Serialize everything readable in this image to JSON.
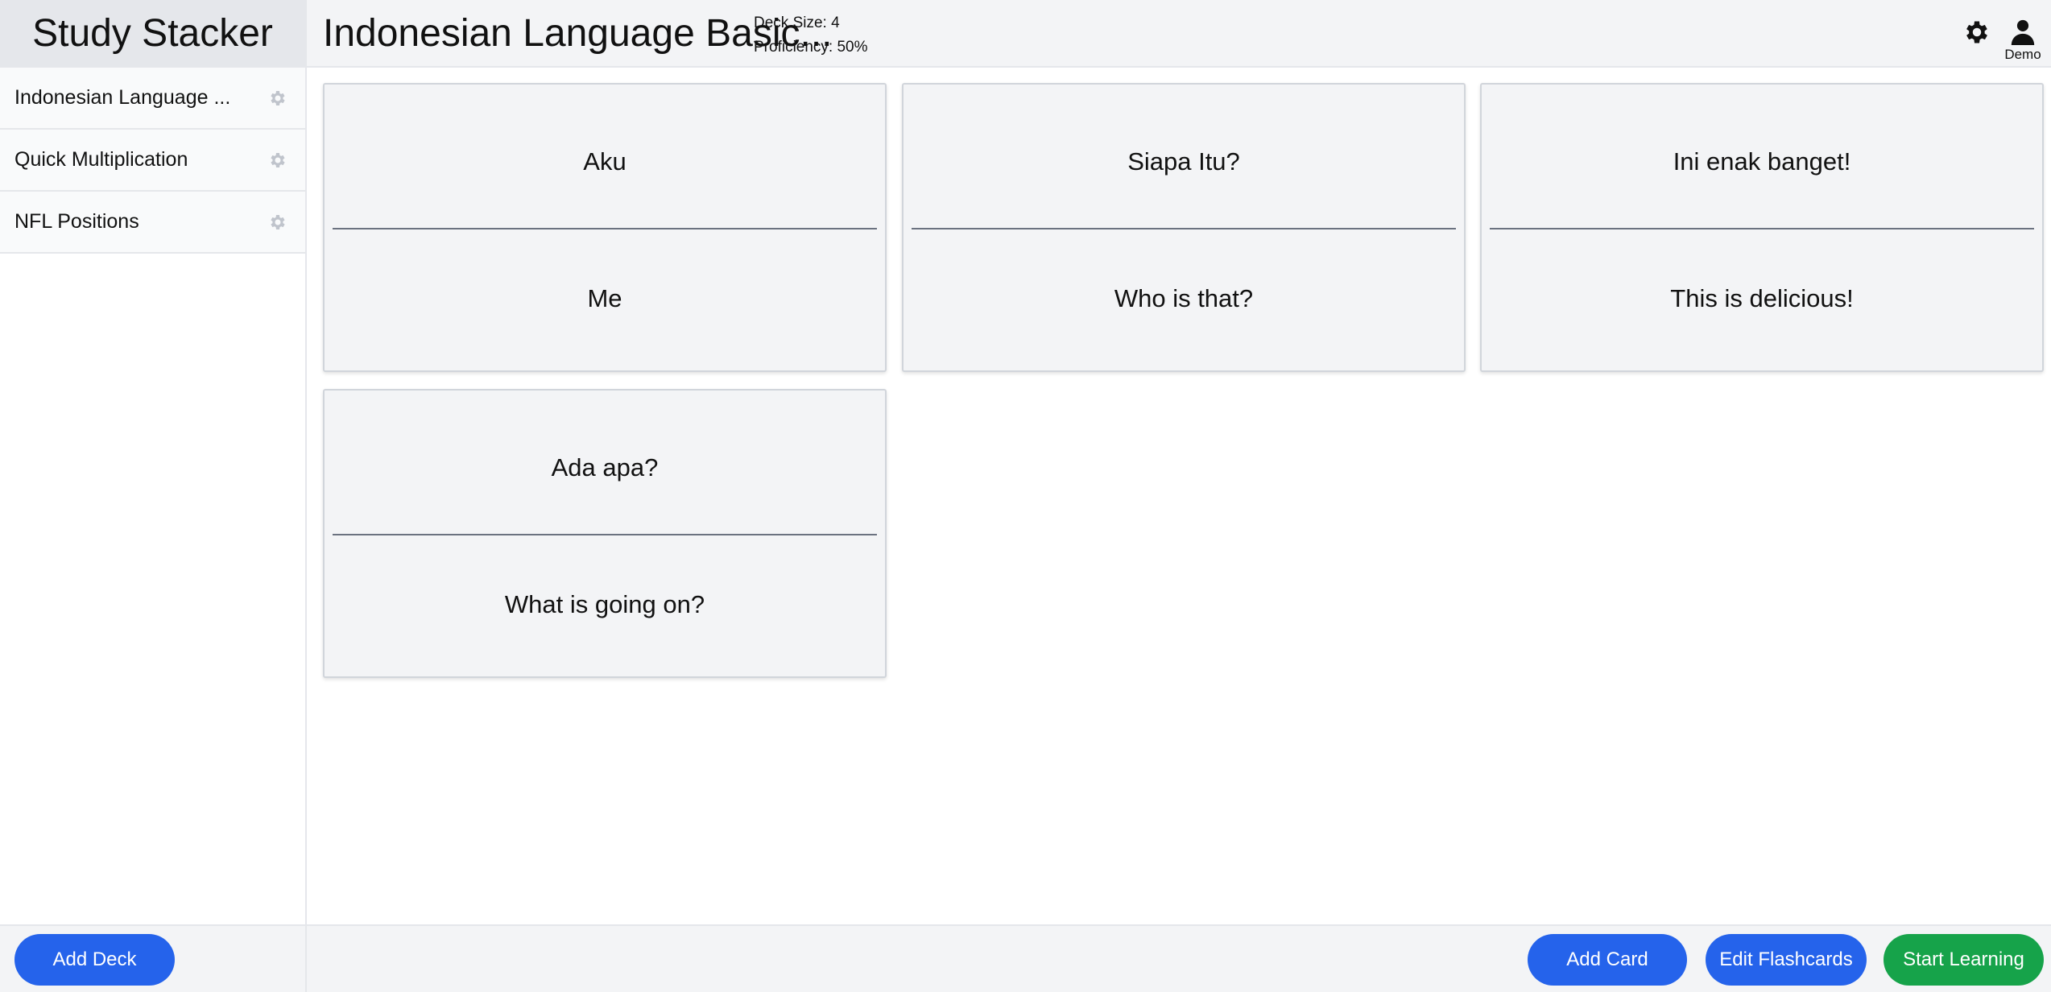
{
  "app": {
    "brand": "Study Stacker"
  },
  "sidebar": {
    "decks": [
      {
        "label": "Indonesian Language ...",
        "icon": "gear-icon"
      },
      {
        "label": "Quick Multiplication",
        "icon": "gear-icon"
      },
      {
        "label": "NFL Positions",
        "icon": "gear-icon"
      }
    ],
    "add_deck_label": "Add Deck"
  },
  "header": {
    "title": "Indonesian Language Basic...",
    "deck_size": "Deck Size: 4",
    "proficiency": "Proficiency: 50%",
    "settings_icon": "gear-icon",
    "user_icon": "user-icon",
    "user_name": "Demo"
  },
  "cards": [
    {
      "front": "Aku",
      "back": "Me"
    },
    {
      "front": "Siapa Itu?",
      "back": "Who is that?"
    },
    {
      "front": "Ini enak banget!",
      "back": "This is delicious!"
    },
    {
      "front": "Ada apa?",
      "back": "What is going on?"
    }
  ],
  "footer": {
    "add_card_label": "Add Card",
    "edit_label": "Edit Flashcards",
    "start_label": "Start Learning"
  },
  "colors": {
    "primary": "#2563eb",
    "success": "#16a34a",
    "panel": "#f3f4f6",
    "border": "#e5e7eb"
  }
}
